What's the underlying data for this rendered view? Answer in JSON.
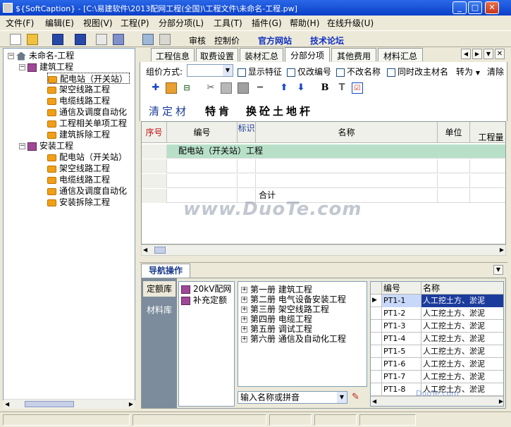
{
  "window": {
    "title": "${SoftCaption} - [C:\\易建软件\\2013配网工程(全国)\\工程文件\\未命名-工程.pw]"
  },
  "menu": [
    "文件(F)",
    "编辑(E)",
    "视图(V)",
    "工程(P)",
    "分部分项(L)",
    "工具(T)",
    "插件(G)",
    "帮助(H)",
    "在线升级(U)"
  ],
  "toolbar": {
    "audit": "审核",
    "control_price": "控制价",
    "official_site": "官方网站",
    "forum": "技术论坛"
  },
  "tree": {
    "root": "未命名-工程",
    "groups": [
      {
        "label": "建筑工程",
        "items": [
          "配电站（开关站）",
          "架空线路工程",
          "电缆线路工程",
          "通信及调度自动化",
          "工程相关单项工程",
          "建筑拆除工程"
        ]
      },
      {
        "label": "安装工程",
        "items": [
          "配电站（开关站）",
          "架空线路工程",
          "电缆线路工程",
          "通信及调度自动化",
          "安装拆除工程"
        ]
      }
    ]
  },
  "tabs": [
    "工程信息",
    "取费设置",
    "装材汇总",
    "分部分项",
    "其他费用",
    "材料汇总"
  ],
  "active_tab": "分部分项",
  "options": {
    "group_label": "组价方式:",
    "group_value": "",
    "show_feature": "显示特征",
    "only_code": "仅改编号",
    "no_name": "不改名称",
    "sync_main": "同时改主材名",
    "convert": "转为",
    "clear": "清除"
  },
  "subtabs": [
    "清定材",
    "特肯",
    "换砼土地杆"
  ],
  "grid": {
    "headers": [
      "序号",
      "编号",
      "标识",
      "名称",
      "单位",
      "工程量"
    ],
    "rows": [
      {
        "section": "配电站（开关站）工程"
      },
      {
        "section": ""
      },
      {
        "section": ""
      },
      {
        "name": "合计"
      }
    ]
  },
  "nav": {
    "title": "导航操作",
    "side": [
      "定额库",
      "材料库"
    ],
    "libraries": [
      "20kV配网",
      "补充定额"
    ],
    "books": [
      "第一册 建筑工程",
      "第二册 电气设备安装工程",
      "第三册 架空线路工程",
      "第四册 电缆工程",
      "第五册 调试工程",
      "第六册 通信及自动化工程"
    ],
    "search_placeholder": "输入名称或拼音",
    "qgrid_headers": [
      "编号",
      "名称"
    ],
    "qrows": [
      {
        "code": "PT1-1",
        "name": "人工挖土方、淤泥"
      },
      {
        "code": "PT1-2",
        "name": "人工挖土方、淤泥"
      },
      {
        "code": "PT1-3",
        "name": "人工挖土方、淤泥"
      },
      {
        "code": "PT1-4",
        "name": "人工挖土方、淤泥"
      },
      {
        "code": "PT1-5",
        "name": "人工挖土方、淤泥"
      },
      {
        "code": "PT1-6",
        "name": "人工挖土方、淤泥"
      },
      {
        "code": "PT1-7",
        "name": "人工挖土方、淤泥"
      },
      {
        "code": "PT1-8",
        "name": "人工挖土方、淤泥"
      }
    ]
  },
  "watermark": "www.DuoTe.com",
  "watermark2": "DuoTe.com"
}
